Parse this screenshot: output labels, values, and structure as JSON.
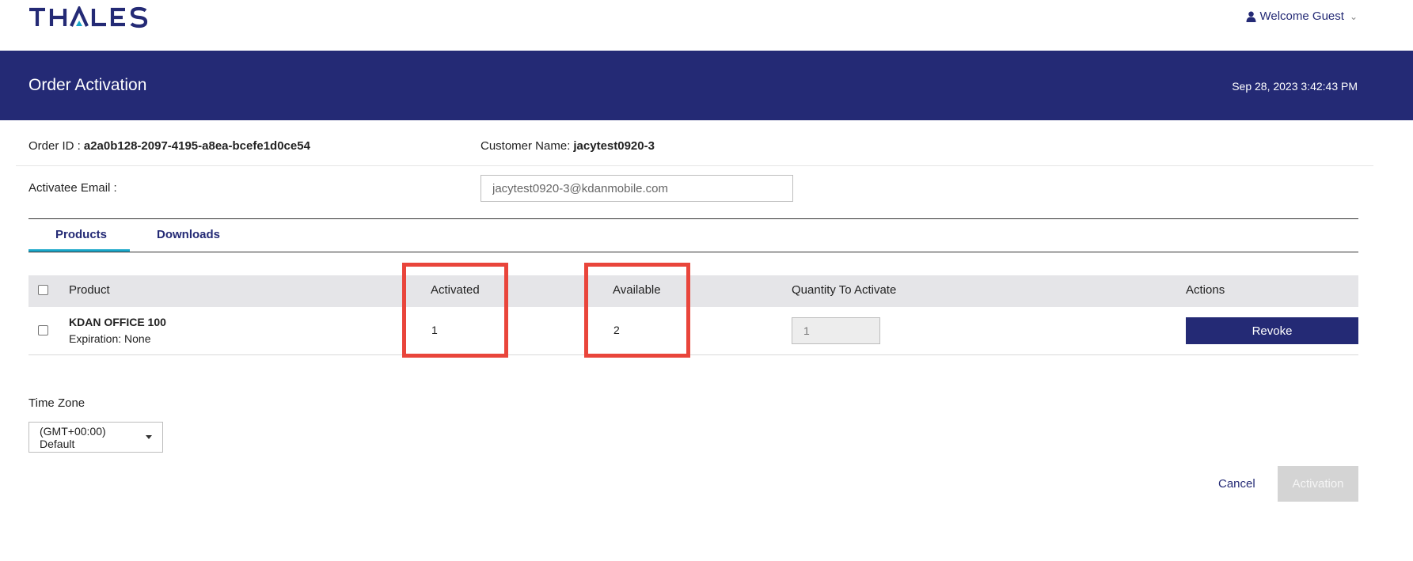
{
  "brand": {
    "logo_text": "THALES",
    "color_primary": "#242a75",
    "color_accent": "#19a7c9"
  },
  "header": {
    "user_icon": "user-icon",
    "welcome_label": "Welcome Guest",
    "dropdown_icon": "chevron-down-icon"
  },
  "banner": {
    "title": "Order Activation",
    "datetime": "Sep 28, 2023 3:42:43 PM"
  },
  "order": {
    "order_id_label": "Order ID :",
    "order_id_value": "a2a0b128-2097-4195-a8ea-bcefe1d0ce54",
    "customer_label": "Customer Name:",
    "customer_value": "jacytest0920-3",
    "email_label": "Activatee Email :",
    "email_value": "jacytest0920-3@kdanmobile.com"
  },
  "tabs": [
    {
      "label": "Products",
      "active": true
    },
    {
      "label": "Downloads",
      "active": false
    }
  ],
  "table": {
    "headers": [
      "Product",
      "Activated",
      "Available",
      "Quantity To Activate",
      "Actions"
    ],
    "rows": [
      {
        "product_name": "KDAN OFFICE 100",
        "expiration": "Expiration: None",
        "activated": "1",
        "available": "2",
        "quantity": "1",
        "action_label": "Revoke"
      }
    ]
  },
  "highlight_color": "#e9453b",
  "timezone": {
    "label": "Time Zone",
    "selected": "(GMT+00:00) Default"
  },
  "footer": {
    "cancel_label": "Cancel",
    "activation_label": "Activation"
  }
}
